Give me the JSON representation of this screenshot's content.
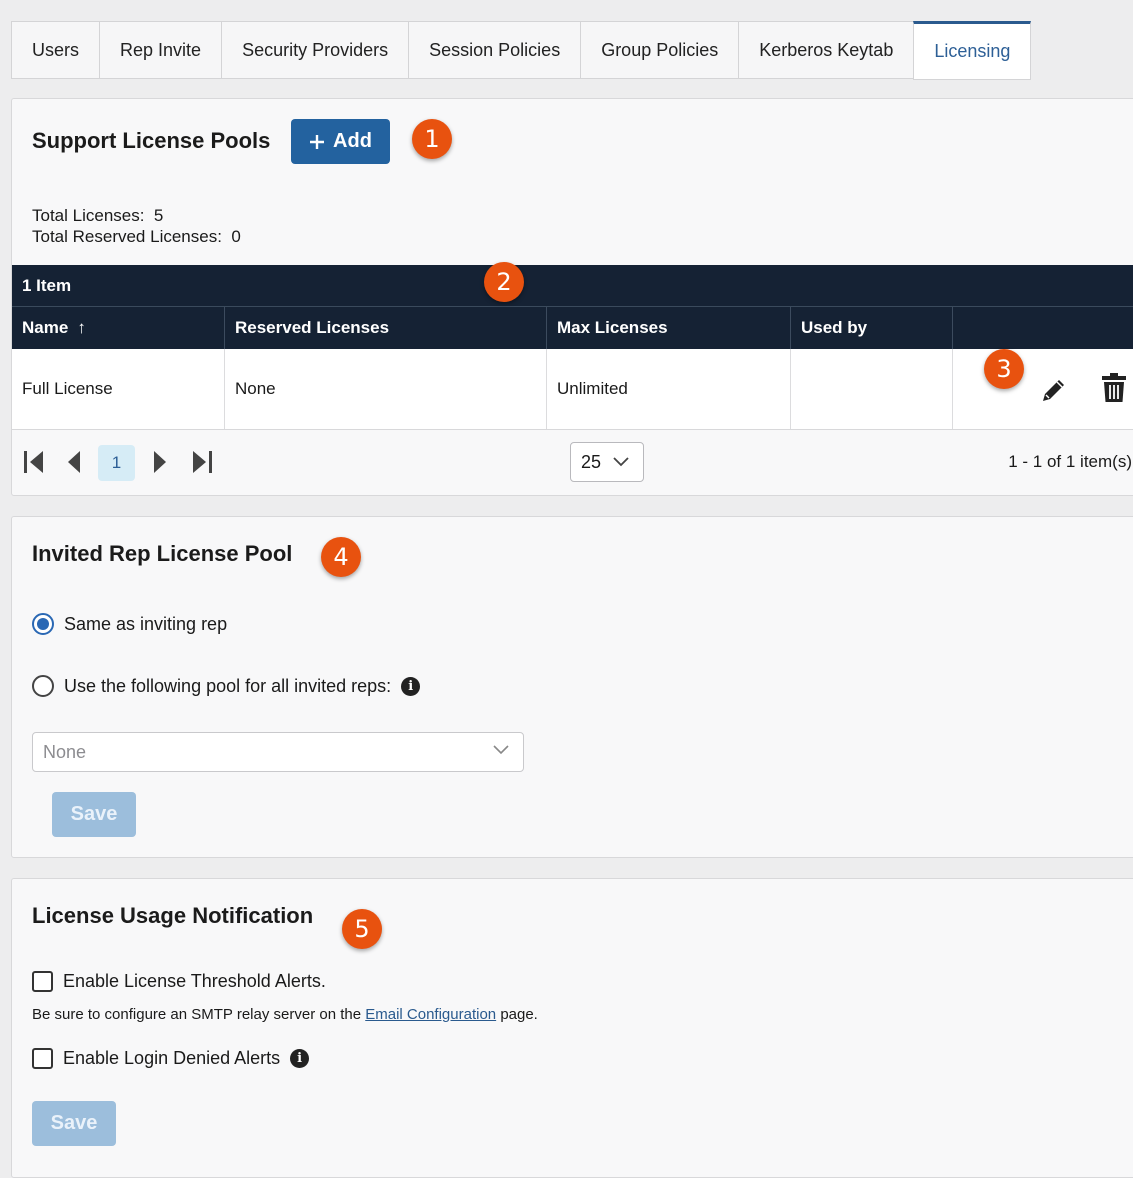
{
  "tabs": [
    {
      "label": "Users"
    },
    {
      "label": "Rep Invite"
    },
    {
      "label": "Security Providers"
    },
    {
      "label": "Session Policies"
    },
    {
      "label": "Group Policies"
    },
    {
      "label": "Kerberos Keytab"
    },
    {
      "label": "Licensing",
      "active": true
    }
  ],
  "support_pools": {
    "title": "Support License Pools",
    "add_label": "Add",
    "badge": "1",
    "total_licenses_label": "Total Licenses:",
    "total_licenses_value": "5",
    "total_reserved_label": "Total Reserved Licenses:",
    "total_reserved_value": "0",
    "grid": {
      "item_count": "1 Item",
      "badge": "2",
      "columns": [
        "Name",
        "Reserved Licenses",
        "Max Licenses",
        "Used by",
        ""
      ],
      "sort_indicator": "↑",
      "rows": [
        {
          "name": "Full License",
          "reserved": "None",
          "max": "Unlimited",
          "used_by": ""
        }
      ],
      "row_badge": "3"
    },
    "pager": {
      "current_page": "1",
      "page_size": "25",
      "info": "1 - 1 of 1 item(s)"
    }
  },
  "invited_rep": {
    "title": "Invited Rep License Pool",
    "badge": "4",
    "option_same": "Same as inviting rep",
    "option_following": "Use the following pool for all invited reps:",
    "select_value": "None",
    "save_label": "Save"
  },
  "usage_notification": {
    "title": "License Usage Notification",
    "badge": "5",
    "threshold_label": "Enable License Threshold Alerts.",
    "note_prefix": "Be sure to configure an SMTP relay server on the",
    "note_link": "Email Configuration",
    "note_suffix": "page.",
    "login_denied_label": "Enable Login Denied Alerts",
    "save_label": "Save"
  },
  "colors": {
    "accent": "#23629f",
    "grid_header": "#152234",
    "badge": "#e8520f",
    "disabled_button": "#9cbedc"
  }
}
